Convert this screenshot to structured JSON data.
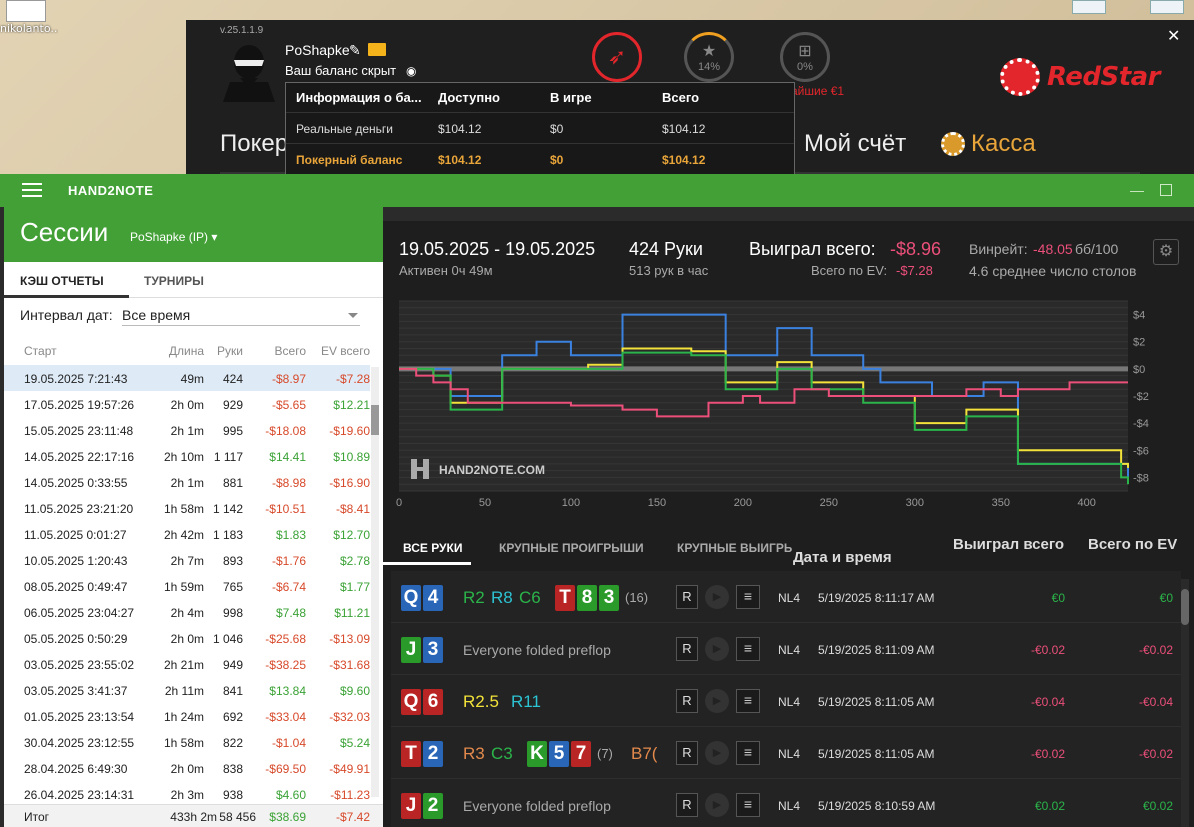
{
  "desktop": {
    "icon_label": "nikolanto..."
  },
  "redstar": {
    "version": "v.25.1.1.9",
    "username": "PoShapke",
    "balance_hidden": "Ваш баланс скрыт",
    "progress1": "14%",
    "progress2": "0%",
    "promo_text": "айшие €1",
    "brand": "RedStar",
    "nav": {
      "poker": "Покер",
      "account": "Мой счёт",
      "cash": "Касса"
    },
    "colors": {
      "brand": "#e3262b",
      "gold": "#e9a53a"
    }
  },
  "balance_popup": {
    "headers": [
      "Информация о ба...",
      "Доступно",
      "В игре",
      "Всего"
    ],
    "rows": [
      [
        "Реальные деньги",
        "$104.12",
        "$0",
        "$104.12"
      ],
      [
        "Покерный баланс",
        "$104.12",
        "$0",
        "$104.12"
      ]
    ]
  },
  "h2n": {
    "app_title": "HAND2NOTE",
    "sessions": {
      "title": "Сессии",
      "player": "PoShapke (IP)",
      "tabs": [
        "КЭШ ОТЧЕТЫ",
        "ТУРНИРЫ"
      ],
      "filter_label": "Интервал дат:",
      "filter_value": "Все время",
      "columns": [
        "Старт",
        "Длина",
        "Руки",
        "Всего",
        "EV всего"
      ],
      "rows": [
        [
          "19.05.2025 7:21:43",
          "49m",
          "424",
          "-$8.97",
          "-$7.28"
        ],
        [
          "17.05.2025 19:57:26",
          "2h 0m",
          "929",
          "-$5.65",
          "$12.21"
        ],
        [
          "15.05.2025 23:11:48",
          "2h 1m",
          "995",
          "-$18.08",
          "-$19.60"
        ],
        [
          "14.05.2025 22:17:16",
          "2h 10m",
          "1 117",
          "$14.41",
          "$10.89"
        ],
        [
          "14.05.2025 0:33:55",
          "2h 1m",
          "881",
          "-$8.98",
          "-$16.90"
        ],
        [
          "11.05.2025 23:21:20",
          "1h 58m",
          "1 142",
          "-$10.51",
          "-$8.41"
        ],
        [
          "11.05.2025 0:01:27",
          "2h 42m",
          "1 183",
          "$1.83",
          "$12.70"
        ],
        [
          "10.05.2025 1:20:43",
          "2h 7m",
          "893",
          "-$1.76",
          "$2.78"
        ],
        [
          "08.05.2025 0:49:47",
          "1h 59m",
          "765",
          "-$6.74",
          "$1.77"
        ],
        [
          "06.05.2025 23:04:27",
          "2h 4m",
          "998",
          "$7.48",
          "$11.21"
        ],
        [
          "05.05.2025 0:50:29",
          "2h 0m",
          "1 046",
          "-$25.68",
          "-$13.09"
        ],
        [
          "03.05.2025 23:55:02",
          "2h 21m",
          "949",
          "-$38.25",
          "-$31.68"
        ],
        [
          "03.05.2025 3:41:37",
          "2h 11m",
          "841",
          "$13.84",
          "$9.60"
        ],
        [
          "01.05.2025 23:13:54",
          "1h 24m",
          "692",
          "-$33.04",
          "-$32.03"
        ],
        [
          "30.04.2025 23:12:55",
          "1h 58m",
          "822",
          "-$1.04",
          "$5.24"
        ],
        [
          "28.04.2025 6:49:30",
          "2h 0m",
          "838",
          "-$69.50",
          "-$49.91"
        ],
        [
          "26.04.2025 23:14:31",
          "2h 3m",
          "938",
          "$4.60",
          "-$11.23"
        ]
      ],
      "footer": [
        "Итог",
        "433h 2m",
        "58 456",
        "$38.69",
        "-$7.42"
      ]
    },
    "summary": {
      "date_range": "19.05.2025 - 19.05.2025",
      "active": "Активен 0ч 49м",
      "hands": "424 Руки",
      "hands_per_hour": "513 рук в час",
      "won_label": "Выиграл всего:",
      "won_value": "-$8.96",
      "ev_label": "Всего по EV:",
      "ev_value": "-$7.28",
      "winrate_label": "Винрейт:",
      "winrate_value": "-48.05",
      "winrate_unit": "бб/100",
      "tables": "4.6 среднее число столов",
      "watermark": "HAND2NOTE.COM"
    },
    "chart_data": {
      "type": "line",
      "xlim": [
        0,
        424
      ],
      "ylim": [
        -9,
        5
      ],
      "x_ticks": [
        0,
        50,
        100,
        150,
        200,
        250,
        300,
        350,
        400
      ],
      "y_ticks": [
        4,
        2,
        0,
        -2,
        -4,
        -6,
        -8
      ],
      "y_tick_labels": [
        "$4",
        "$2",
        "$0",
        "-$2",
        "-$4",
        "-$6",
        "-$8"
      ],
      "series": [
        {
          "color": "#3b82e0",
          "x": [
            0,
            10,
            20,
            30,
            40,
            50,
            60,
            70,
            80,
            90,
            100,
            110,
            120,
            130,
            140,
            150,
            160,
            170,
            180,
            190,
            200,
            210,
            220,
            230,
            240,
            250,
            260,
            270,
            280,
            290,
            300,
            310,
            320,
            330,
            340,
            350,
            360,
            370,
            380,
            390,
            400,
            410,
            420,
            424
          ],
          "y": [
            0,
            0,
            0,
            -2,
            -2,
            -2,
            1,
            1,
            2,
            2,
            1,
            1,
            1,
            4,
            4,
            4,
            4,
            4,
            4,
            1,
            1,
            1,
            3,
            3,
            1,
            1,
            1,
            0,
            -1,
            -1,
            -1,
            -2,
            -2,
            -2,
            -1,
            -1,
            -7,
            -7,
            -7,
            -7,
            -7,
            -7,
            -7,
            -8
          ]
        },
        {
          "color": "#f3e23a",
          "x": [
            0,
            10,
            20,
            30,
            40,
            50,
            60,
            70,
            80,
            90,
            100,
            110,
            120,
            130,
            140,
            150,
            160,
            170,
            180,
            190,
            200,
            210,
            220,
            230,
            240,
            250,
            260,
            270,
            280,
            290,
            300,
            310,
            320,
            330,
            340,
            350,
            360,
            370,
            380,
            390,
            400,
            410,
            420,
            424
          ],
          "y": [
            0,
            0,
            -0.5,
            -2.5,
            -2.5,
            -2.5,
            0,
            0,
            0,
            0,
            0,
            0.3,
            0.3,
            1.5,
            1.5,
            1.5,
            1.5,
            1.3,
            1.3,
            -1,
            -1,
            -1,
            0.5,
            0.5,
            -1,
            -1,
            -1,
            -2,
            -2,
            -2,
            -4,
            -4,
            -4,
            -3,
            -3,
            -3,
            -6,
            -6,
            -6,
            -6,
            -6,
            -6,
            -7,
            -7.3
          ]
        },
        {
          "color": "#2bb44a",
          "x": [
            0,
            10,
            20,
            30,
            40,
            50,
            60,
            70,
            80,
            90,
            100,
            110,
            120,
            130,
            140,
            150,
            160,
            170,
            180,
            190,
            200,
            210,
            220,
            230,
            240,
            250,
            260,
            270,
            280,
            290,
            300,
            310,
            320,
            330,
            340,
            350,
            360,
            370,
            380,
            390,
            400,
            410,
            420,
            424
          ],
          "y": [
            0,
            0,
            -0.5,
            -3,
            -3,
            -3,
            0,
            0,
            0,
            0,
            0,
            0,
            0,
            1.2,
            1.2,
            1.2,
            1.2,
            1,
            1,
            -1.5,
            -1.5,
            -1.5,
            0,
            0,
            -1.5,
            -1.5,
            -1.5,
            -2.5,
            -2.5,
            -2.5,
            -4.5,
            -4.5,
            -4.5,
            -3.5,
            -3.5,
            -3.5,
            -7,
            -7,
            -7,
            -7,
            -7,
            -7,
            -8,
            -8.5
          ]
        },
        {
          "color": "#ec4f7a",
          "x": [
            0,
            10,
            20,
            30,
            40,
            50,
            60,
            70,
            80,
            90,
            100,
            110,
            120,
            130,
            140,
            150,
            160,
            170,
            180,
            190,
            200,
            210,
            220,
            230,
            240,
            250,
            260,
            270,
            280,
            290,
            300,
            310,
            320,
            330,
            340,
            350,
            360,
            370,
            380,
            390,
            400,
            410,
            420,
            424
          ],
          "y": [
            0,
            -0.5,
            -1,
            -1.5,
            -2.5,
            -2.5,
            -2.5,
            -2.5,
            -2.5,
            -2.5,
            -2.7,
            -2.7,
            -2.7,
            -3,
            -3,
            -3.5,
            -3.5,
            -3.5,
            -2.5,
            -2.5,
            -2,
            -2.5,
            -2.5,
            -1.5,
            -1.5,
            -2,
            -2,
            -2,
            -2,
            -2,
            -2,
            -2,
            -2,
            -1.5,
            -1.5,
            -2,
            -1.5,
            -1.5,
            -1.5,
            -1,
            -1,
            -1,
            -1,
            -1
          ]
        }
      ]
    },
    "hands_list": {
      "tabs": [
        "ВСЕ РУКИ",
        "КРУПНЫЕ ПРОИГРЫШИ",
        "КРУПНЫЕ ВЫИГРЫ"
      ],
      "col_datetime": "Дата и время",
      "col_datetime_sort": "↓",
      "col_won": "Выиграл всего",
      "col_ev": "Всего по EV",
      "rows": [
        {
          "cards": [
            [
              "Q",
              "s"
            ],
            [
              "4",
              "s"
            ]
          ],
          "actions": [
            [
              "R2",
              "grn"
            ],
            [
              "R8",
              "cy"
            ],
            [
              "C6",
              "grn"
            ]
          ],
          "board": [
            [
              "T",
              "h"
            ],
            [
              "8",
              "c"
            ],
            [
              "3",
              "c"
            ]
          ],
          "count": "(16)",
          "fold": "",
          "limit": "NL4",
          "datetime": "5/19/2025 8:11:17 AM",
          "won": "€0",
          "ev": "€0",
          "won_c": "g",
          "ev_c": "g"
        },
        {
          "cards": [
            [
              "J",
              "c"
            ],
            [
              "3",
              "s"
            ]
          ],
          "actions": [],
          "board": [],
          "count": "",
          "fold": "Everyone folded preflop",
          "limit": "NL4",
          "datetime": "5/19/2025 8:11:09 AM",
          "won": "-€0.02",
          "ev": "-€0.02",
          "won_c": "r",
          "ev_c": "r"
        },
        {
          "cards": [
            [
              "Q",
              "h"
            ],
            [
              "6",
              "h"
            ]
          ],
          "actions": [
            [
              "R2.5",
              "yel"
            ],
            [
              "R11",
              "cy"
            ]
          ],
          "board": [],
          "count": "",
          "fold": "",
          "limit": "NL4",
          "datetime": "5/19/2025 8:11:05 AM",
          "won": "-€0.04",
          "ev": "-€0.04",
          "won_c": "r",
          "ev_c": "r"
        },
        {
          "cards": [
            [
              "T",
              "h"
            ],
            [
              "2",
              "s"
            ]
          ],
          "actions": [
            [
              "R3",
              "or"
            ],
            [
              "C3",
              "grn"
            ]
          ],
          "board": [
            [
              "K",
              "c"
            ],
            [
              "5",
              "s"
            ],
            [
              "7",
              "h"
            ]
          ],
          "count": "(7)",
          "extra": "B7(",
          "fold": "",
          "limit": "NL4",
          "datetime": "5/19/2025 8:11:05 AM",
          "won": "-€0.02",
          "ev": "-€0.02",
          "won_c": "r",
          "ev_c": "r"
        },
        {
          "cards": [
            [
              "J",
              "h"
            ],
            [
              "2",
              "c"
            ]
          ],
          "actions": [],
          "board": [],
          "count": "",
          "fold": "Everyone folded preflop",
          "limit": "NL4",
          "datetime": "5/19/2025 8:10:59 AM",
          "won": "€0.02",
          "ev": "€0.02",
          "won_c": "g",
          "ev_c": "g"
        }
      ],
      "r_label": "R"
    }
  }
}
